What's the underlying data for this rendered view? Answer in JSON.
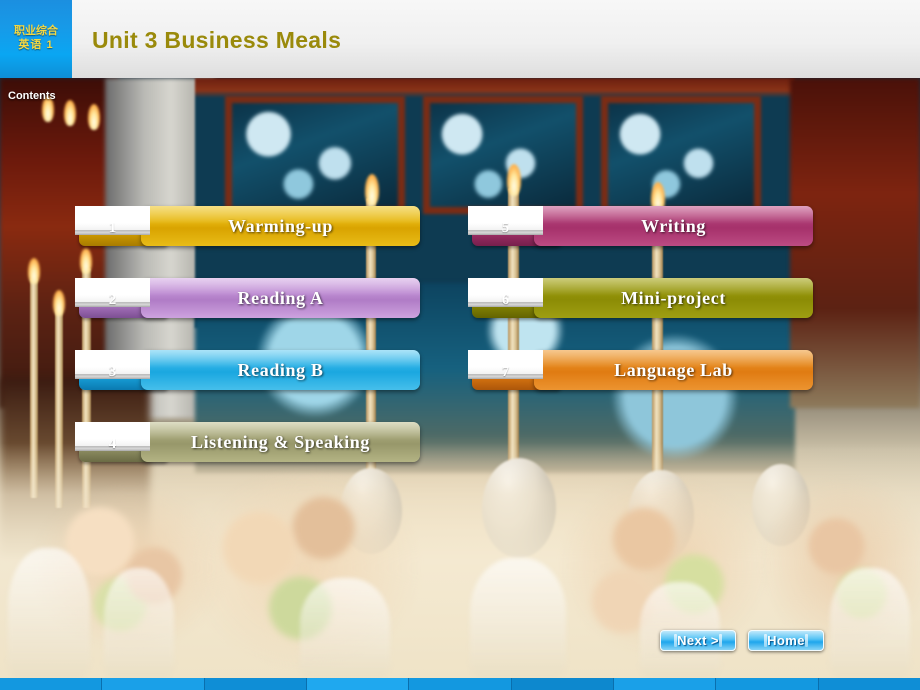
{
  "header": {
    "logo_line1": "职业综合",
    "logo_line2": "英语 1",
    "title_unit": "Unit 3",
    "title_sub": "Business Meals",
    "title_color": "#9a8a0b",
    "logo_bg_color": "#0aa6f2"
  },
  "contents_label": "Contents",
  "menu": {
    "left_items": [
      {
        "number": "1",
        "label": "Warming-up",
        "color": "#d9a300",
        "color_light": "#f0c92e",
        "color_dark": "#a77b00"
      },
      {
        "number": "2",
        "label": "Reading A",
        "color": "#b07cc6",
        "color_light": "#d3a9e2",
        "color_dark": "#7d4f93"
      },
      {
        "number": "3",
        "label": "Reading B",
        "color": "#1aa7e0",
        "color_light": "#6fd0f3",
        "color_dark": "#0b7ab0"
      },
      {
        "number": "4",
        "label": "Listening  &  Speaking",
        "color": "#97976a",
        "color_light": "#c2c295",
        "color_dark": "#6b6b45"
      }
    ],
    "right_items": [
      {
        "number": "5",
        "label": "Writing",
        "color": "#a6316b",
        "color_light": "#cf6498",
        "color_dark": "#761f4c"
      },
      {
        "number": "6",
        "label": "Mini-project",
        "color": "#8c8c05",
        "color_light": "#bcbc2e",
        "color_dark": "#636300"
      },
      {
        "number": "7",
        "label": "Language  Lab",
        "color": "#e07b12",
        "color_light": "#f5a646",
        "color_dark": "#ac560a"
      }
    ]
  },
  "nav": {
    "next_label": "Next >",
    "home_label": "Home",
    "accent_color": "#1fa6ec"
  },
  "bottom_bar": {
    "color": "#1398e0",
    "segments": 9
  }
}
